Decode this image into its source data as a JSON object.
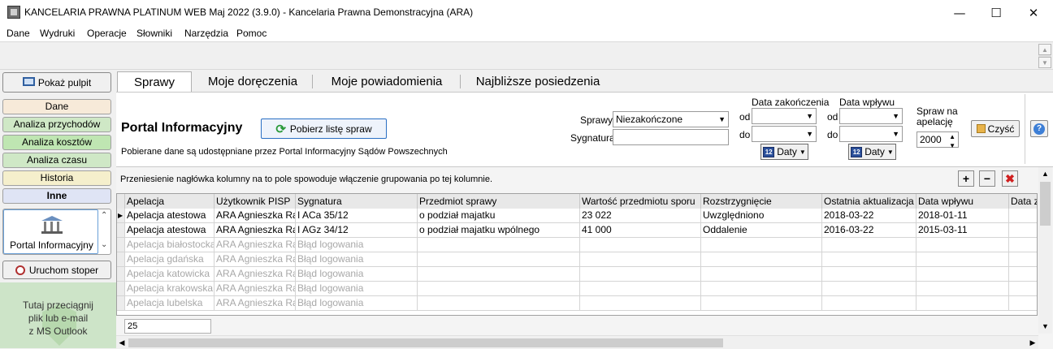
{
  "window": {
    "title": "KANCELARIA PRAWNA PLATINUM WEB Maj 2022 (3.9.0)  -  Kancelaria Prawna Demonstracyjna  (ARA)",
    "minimize": "—",
    "maximize": "☐",
    "close": "✕"
  },
  "menu": [
    "Dane",
    "Wydruki",
    "Operacje",
    "Słowniki",
    "Narzędzia",
    "Pomoc"
  ],
  "left": {
    "show_desktop": "Pokaż pulpit",
    "nav": [
      {
        "label": "Dane",
        "color": "#f7ead9"
      },
      {
        "label": "Analiza przychodów",
        "color": "#cfe8c6"
      },
      {
        "label": "Analiza kosztów",
        "color": "#bfe6b2"
      },
      {
        "label": "Analiza czasu",
        "color": "#cfe8c6"
      },
      {
        "label": "Historia",
        "color": "#f5efcc"
      },
      {
        "label": "Inne",
        "color": "#dfe4f5"
      }
    ],
    "portal": "Portal Informacyjny",
    "stopwatch": "Uruchom stoper",
    "drop": [
      "Tutaj przeciągnij",
      "plik lub e-mail",
      "z MS Outlook"
    ]
  },
  "tabs": [
    "Sprawy",
    "Moje doręczenia",
    "Moje powiadomienia",
    "Najbliższe posiedzenia"
  ],
  "panel": {
    "title": "Portal Informacyjny",
    "fetch_button": "Pobierz listę spraw",
    "info": "Pobierane dane są udostępniane przez Portal Informacyjny Sądów Powszechnych",
    "sprawy_label": "Sprawy",
    "sprawy_value": "Niezakończone",
    "sygnatura_label": "Sygnatura",
    "sygnatura_value": "",
    "data_zak": "Data zakończenia",
    "data_wpl": "Data wpływu",
    "od": "od",
    "do": "do",
    "daty": "Daty",
    "sprawna_apel_1": "Spraw na",
    "sprawna_apel_2": "apelację",
    "apel_value": "2000",
    "clear": "Czyść"
  },
  "grid": {
    "group_hint": "Przeniesienie nagłówka kolumny na to pole spowoduje włączenie grupowania po tej kolumnie.",
    "columns": [
      "Apelacja",
      "Użytkownik PISP",
      "Sygnatura",
      "Przedmiot sprawy",
      "Wartość przedmiotu sporu",
      "Rozstrzygnięcie",
      "Ostatnia aktualizacja",
      "Data wpływu",
      "Data z"
    ],
    "rows": [
      {
        "c": [
          "Apelacja atestowa",
          "ARA Agnieszka Rak",
          "I ACa 35/12",
          "o podział majatku",
          "23 022",
          "Uwzględniono",
          "2018-03-22",
          "2018-01-11",
          ""
        ],
        "grey": false,
        "current": true
      },
      {
        "c": [
          "Apelacja atestowa",
          "ARA Agnieszka Rak",
          "I AGz 34/12",
          "o podział majatku wpólnego",
          "41 000",
          "Oddalenie",
          "2016-03-22",
          "2015-03-11",
          ""
        ],
        "grey": false,
        "current": false
      },
      {
        "c": [
          "Apelacja białostocka",
          "ARA Agnieszka Rak",
          "Błąd logowania",
          "",
          "",
          "",
          "",
          "",
          ""
        ],
        "grey": true,
        "current": false
      },
      {
        "c": [
          "Apelacja gdańska",
          "ARA Agnieszka Rak",
          "Błąd logowania",
          "",
          "",
          "",
          "",
          "",
          ""
        ],
        "grey": true,
        "current": false
      },
      {
        "c": [
          "Apelacja katowicka",
          "ARA Agnieszka Rak",
          "Błąd logowania",
          "",
          "",
          "",
          "",
          "",
          ""
        ],
        "grey": true,
        "current": false
      },
      {
        "c": [
          "Apelacja krakowska",
          "ARA Agnieszka Rak",
          "Błąd logowania",
          "",
          "",
          "",
          "",
          "",
          ""
        ],
        "grey": true,
        "current": false
      },
      {
        "c": [
          "Apelacja lubelska",
          "ARA Agnieszka Rak",
          "Błąd logowania",
          "",
          "",
          "",
          "",
          "",
          ""
        ],
        "grey": true,
        "current": false
      }
    ],
    "count": "25"
  }
}
